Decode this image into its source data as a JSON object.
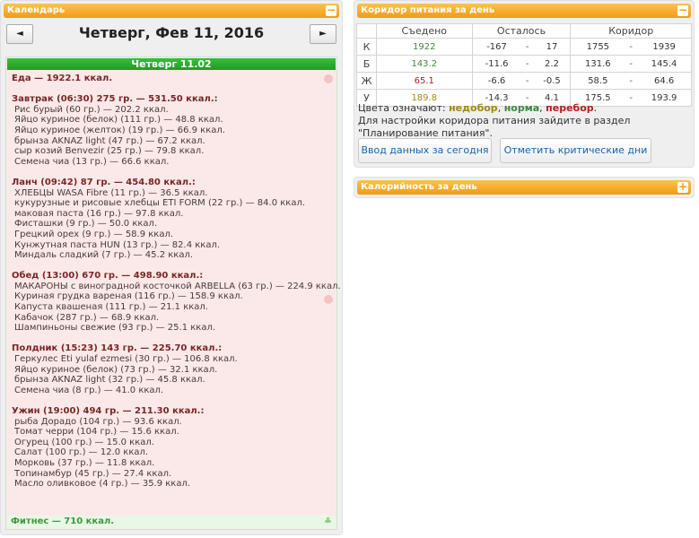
{
  "calendar": {
    "title": "Календарь",
    "collapse": "−",
    "prev": "◄",
    "next": "►",
    "date": "Четверг, Фев 11, 2016",
    "day_header": "Четверг 11.02",
    "food_total": "Еда — 1922.1 ккал.",
    "meals": [
      {
        "title": "Завтрак (06:30) 275 гр. — 531.50 ккал.:",
        "items": [
          "Рис бурый (60 гр.) — 202.2 ккал.",
          "Яйцо куриное (белок) (111 гр.) — 48.8 ккал.",
          "Яйцо куриное (желток) (19 гр.) — 66.9 ккал.",
          "брынза AKNAZ light (47 гр.) — 67.2 ккал.",
          "сыр козий Benvezir (25 гр.) — 79.8 ккал.",
          "Семена чиа (13 гр.) — 66.6 ккал."
        ]
      },
      {
        "title": "Ланч (09:42) 87 гр. — 454.80 ккал.:",
        "items": [
          "ХЛЕБЦЫ WASA Fibre (11 гр.) — 36.5 ккал.",
          "кукурузные и рисовые хлебцы ETI FORM (22 гр.) — 84.0 ккал.",
          "маковая паста (16 гр.) — 97.8 ккал.",
          "Фисташки (9 гр.) — 50.0 ккал.",
          "Грецкий орех (9 гр.) — 58.9 ккал.",
          "Кунжутная паста HUN (13 гр.) — 82.4 ккал.",
          "Миндаль сладкий (7 гр.) — 45.2 ккал."
        ]
      },
      {
        "title": "Обед (13:00) 670 гр. — 498.90 ккал.:",
        "items": [
          "МАКАРОНЫ с виноградной косточкой ARBELLA (63 гр.) — 224.9 ккал.",
          "Куриная грудка вареная (116 гр.) — 158.9 ккал.",
          "Капуста квашеная (111 гр.) — 21.1 ккал.",
          "Кабачок (287 гр.) — 68.9 ккал.",
          "Шампиньоны свежие (93 гр.) — 25.1 ккал."
        ]
      },
      {
        "title": "Полдник (15:23) 143 гр. — 225.70 ккал.:",
        "items": [
          "Геркулес Eti yulaf ezmesi (30 гр.) — 106.8 ккал.",
          "Яйцо куриное (белок) (73 гр.) — 32.1 ккал.",
          "брынза AKNAZ light (32 гр.) — 45.8 ккал.",
          "Семена чиа (8 гр.) — 41.0 ккал."
        ]
      },
      {
        "title": "Ужин (19:00) 494 гр. — 211.30 ккал.:",
        "items": [
          "рыба Дорадо (104 гр.) — 93.6 ккал.",
          "Томат черри (104 гр.) — 15.6 ккал.",
          "Огурец (100 гр.) — 15.0 ккал.",
          "Салат (100 гр.) — 12.0 ккал.",
          "Морковь (37 гр.) — 11.8 ккал.",
          "Топинамбур (45 гр.) — 27.4 ккал.",
          "Масло оливковое (4 гр.) — 35.9 ккал."
        ]
      }
    ],
    "fitness": "Фитнес — 710 ккал."
  },
  "corridor": {
    "title": "Коридор питания за день",
    "collapse": "−",
    "headers": [
      "Съедено",
      "Осталось",
      "Коридор"
    ],
    "dash": "-",
    "rows": [
      {
        "label": "К",
        "eaten": "1922",
        "eaten_color": "g",
        "rem_lo": "-167",
        "rem_hi": "17",
        "cor_lo": "1755",
        "cor_hi": "1939"
      },
      {
        "label": "Б",
        "eaten": "143.2",
        "eaten_color": "g",
        "rem_lo": "-11.6",
        "rem_hi": "2.2",
        "cor_lo": "131.6",
        "cor_hi": "145.4"
      },
      {
        "label": "Ж",
        "eaten": "65.1",
        "eaten_color": "r",
        "rem_lo": "-6.6",
        "rem_hi": "-0.5",
        "cor_lo": "58.5",
        "cor_hi": "64.6"
      },
      {
        "label": "У",
        "eaten": "189.8",
        "eaten_color": "o",
        "rem_lo": "-14.3",
        "rem_hi": "4.1",
        "cor_lo": "175.5",
        "cor_hi": "193.9"
      }
    ],
    "colors_prefix": "Цвета означают:",
    "legend_under": "недобор",
    "legend_norm": "норма",
    "legend_over": "перебор",
    "legend_comma": ",",
    "legend_end": ".",
    "hint1": "Для настройки коридора питания зайдите в раздел",
    "hint2": "\"Планирование питания\".",
    "btn_today": "Ввод данных за сегодня",
    "btn_critical": "Отметить критические дни"
  },
  "calorie": {
    "title": "Калорийность за день",
    "expand": "+"
  },
  "colors": {
    "accent": "#f29a18",
    "day_green": "#1f9a27",
    "under": "#a08a10",
    "norm": "#3c8a3c",
    "over": "#b21f1f"
  }
}
